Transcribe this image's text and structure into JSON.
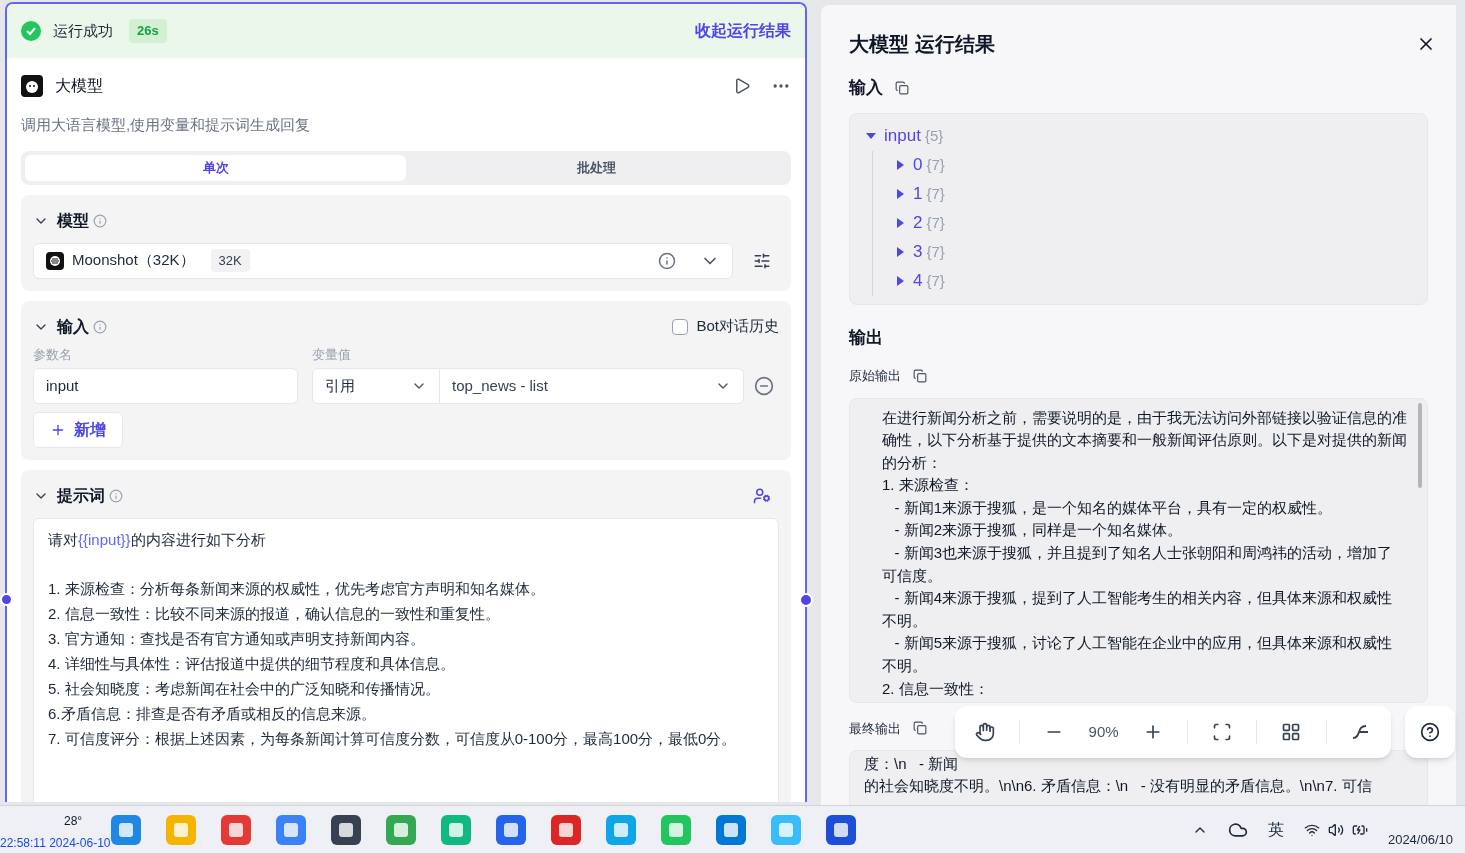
{
  "node": {
    "status": "运行成功",
    "duration": "26s",
    "collapse_link": "收起运行结果",
    "title": "大模型",
    "description": "调用大语言模型,使用变量和提示词生成回复",
    "tabs": [
      {
        "label": "单次",
        "selected": true
      },
      {
        "label": "批处理",
        "selected": false
      }
    ],
    "model_section": {
      "title": "模型",
      "expanded": true,
      "model_name": "Moonshot（32K）",
      "context_badge": "32K"
    },
    "input_section": {
      "title": "输入",
      "expanded": true,
      "bot_history": {
        "label": "Bot对话历史",
        "checked": false
      },
      "columns": [
        "参数名",
        "变量值"
      ],
      "params": [
        {
          "name": "input",
          "source": "引用",
          "value": "top_news - list"
        }
      ],
      "add_button": "新增"
    },
    "prompt_section": {
      "title": "提示词",
      "expanded": true,
      "first_line": {
        "before": "请对",
        "variable": "{{input}}",
        "after": "的内容进行如下分析"
      },
      "lines": [
        "1. 来源检查：分析每条新闻来源的权威性，优先考虑官方声明和知名媒体。",
        "2. 信息一致性：比较不同来源的报道，确认信息的一致性和重复性。",
        "3. 官方通知：查找是否有官方通知或声明支持新闻内容。",
        "4. 详细性与具体性：评估报道中提供的细节程度和具体信息。",
        "5. 社会知晓度：考虑新闻在社会中的广泛知晓和传播情况。",
        "6.矛盾信息：排查是否有矛盾或相反的信息来源。",
        "7. 可信度评分：根据上述因素，为每条新闻计算可信度分数，可信度从0-100分，最高100分，最低0分。"
      ]
    }
  },
  "result_panel": {
    "title": "大模型 运行结果",
    "input_label": "输入",
    "tree": {
      "label": "input",
      "count": "{5}",
      "expanded": true,
      "children": [
        {
          "label": "0",
          "count": "{7}",
          "expanded": false
        },
        {
          "label": "1",
          "count": "{7}",
          "expanded": false
        },
        {
          "label": "2",
          "count": "{7}",
          "expanded": false
        },
        {
          "label": "3",
          "count": "{7}",
          "expanded": false
        },
        {
          "label": "4",
          "count": "{7}",
          "expanded": false
        }
      ]
    },
    "output_label": "输出",
    "raw_label": "原始输出",
    "raw_lines": [
      "在进行新闻分析之前，需要说明的是，由于我无法访问外部链接以验证信息的准确性，以下分析基于提供的文本摘要和一般新闻评估原则。以下是对提供的新闻的分析：",
      "1. 来源检查：",
      "   - 新闻1来源于搜狐，是一个知名的媒体平台，具有一定的权威性。",
      "   - 新闻2来源于搜狐，同样是一个知名媒体。",
      "   - 新闻3也来源于搜狐，并且提到了知名人士张朝阳和周鸿祎的活动，增加了可信度。",
      "   - 新闻4来源于搜狐，提到了人工智能考生的相关内容，但具体来源和权威性不明。",
      "   - 新闻5来源于搜狐，讨论了人工智能在企业中的应用，但具体来源和权威性不明。",
      "2. 信息一致性："
    ],
    "final_label": "最终输出",
    "final_lines": [
      "度：\\n   - 新闻",
      "的社会知晓度不明。\\n\\n6. 矛盾信息：\\n   - 没有明显的矛盾信息。\\n\\n7. 可信"
    ]
  },
  "canvas_toolbar": {
    "zoom": "90%"
  },
  "taskbar": {
    "weather": "28°",
    "overlay_clock": "22:58:11 2024-06-10",
    "input_method": "英",
    "date": "2024/06/10"
  }
}
